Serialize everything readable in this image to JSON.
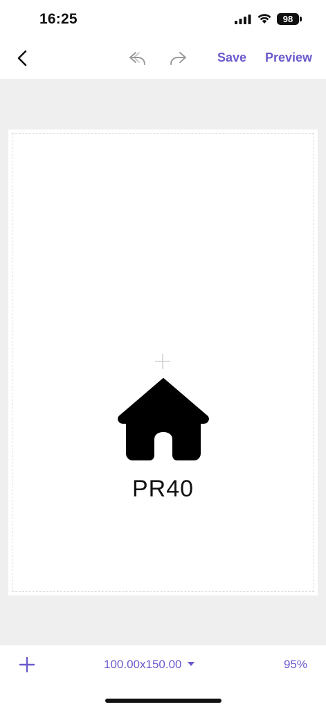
{
  "status_bar": {
    "time": "16:25",
    "battery": "98",
    "icons": [
      "signal-icon",
      "wifi-icon",
      "battery-icon"
    ]
  },
  "nav": {
    "back_icon": "chevron-left-icon",
    "undo_icon": "undo-icon",
    "redo_icon": "redo-icon",
    "save_label": "Save",
    "preview_label": "Preview"
  },
  "canvas": {
    "icon": "home-icon",
    "text": "PR40"
  },
  "toolbar": {
    "add_icon": "plus-icon",
    "size_value": "100.00x150.00",
    "zoom_value": "95%"
  },
  "colors": {
    "accent": "#6a5acd",
    "workspace_bg": "#efefef",
    "icon_disabled": "#9a9a9a"
  }
}
